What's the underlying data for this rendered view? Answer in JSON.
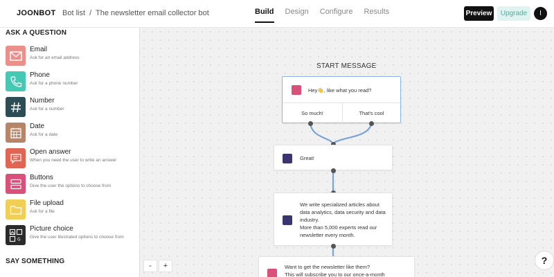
{
  "header": {
    "brand": "JOONBOT",
    "breadcrumb_root": "Bot list",
    "breadcrumb_sep": "/",
    "breadcrumb_current": "The newsletter email collector bot",
    "tabs": [
      {
        "label": "Build",
        "active": true
      },
      {
        "label": "Design",
        "active": false
      },
      {
        "label": "Configure",
        "active": false
      },
      {
        "label": "Results",
        "active": false
      }
    ],
    "preview_label": "Preview",
    "upgrade_label": "Upgrade",
    "avatar_initial": "I"
  },
  "sidebar": {
    "ask_title": "ASK A QUESTION",
    "items": [
      {
        "label": "Email",
        "sub": "Ask for an email address",
        "icon": "envelope-icon",
        "color": "#e9908a"
      },
      {
        "label": "Phone",
        "sub": "Ask for a phone number",
        "icon": "phone-icon",
        "color": "#45c9b4"
      },
      {
        "label": "Number",
        "sub": "Ask for a number",
        "icon": "hash-icon",
        "color": "#2c4d55"
      },
      {
        "label": "Date",
        "sub": "Ask for a date",
        "icon": "calendar-icon",
        "color": "#b7866a"
      },
      {
        "label": "Open answer",
        "sub": "When you need the user to write an answer",
        "icon": "chat-icon",
        "color": "#e06552"
      },
      {
        "label": "Buttons",
        "sub": "Give the user the options to choose from",
        "icon": "buttons-icon",
        "color": "#d9507a"
      },
      {
        "label": "File upload",
        "sub": "Ask for a file",
        "icon": "folder-icon",
        "color": "#f1ce55"
      },
      {
        "label": "Picture choice",
        "sub": "Give the user illustrated options to choose from",
        "icon": "picture-icon",
        "color": "#2b2b2b"
      }
    ],
    "say_title": "SAY SOMETHING"
  },
  "canvas": {
    "start_label": "START MESSAGE",
    "start_text": "Hey👋, like what you read?",
    "choices": [
      "So much!",
      "That's cool"
    ],
    "great_text": "Great!",
    "info_lines": [
      "We write specialized articles about",
      "data analytics, data security and data",
      "industry.",
      "More than 5,000 experts read our",
      "newsletter every month."
    ],
    "ask_lines": [
      "Want to get the newsletter like them?",
      "This will subscribe you to our once-a-month"
    ],
    "zoom_out": "-",
    "zoom_in": "+",
    "help": "?"
  },
  "colors": {
    "accent_blue": "#6f9fd8",
    "node_icon_pink": "#d9507a",
    "node_icon_purple": "#3a3570"
  }
}
